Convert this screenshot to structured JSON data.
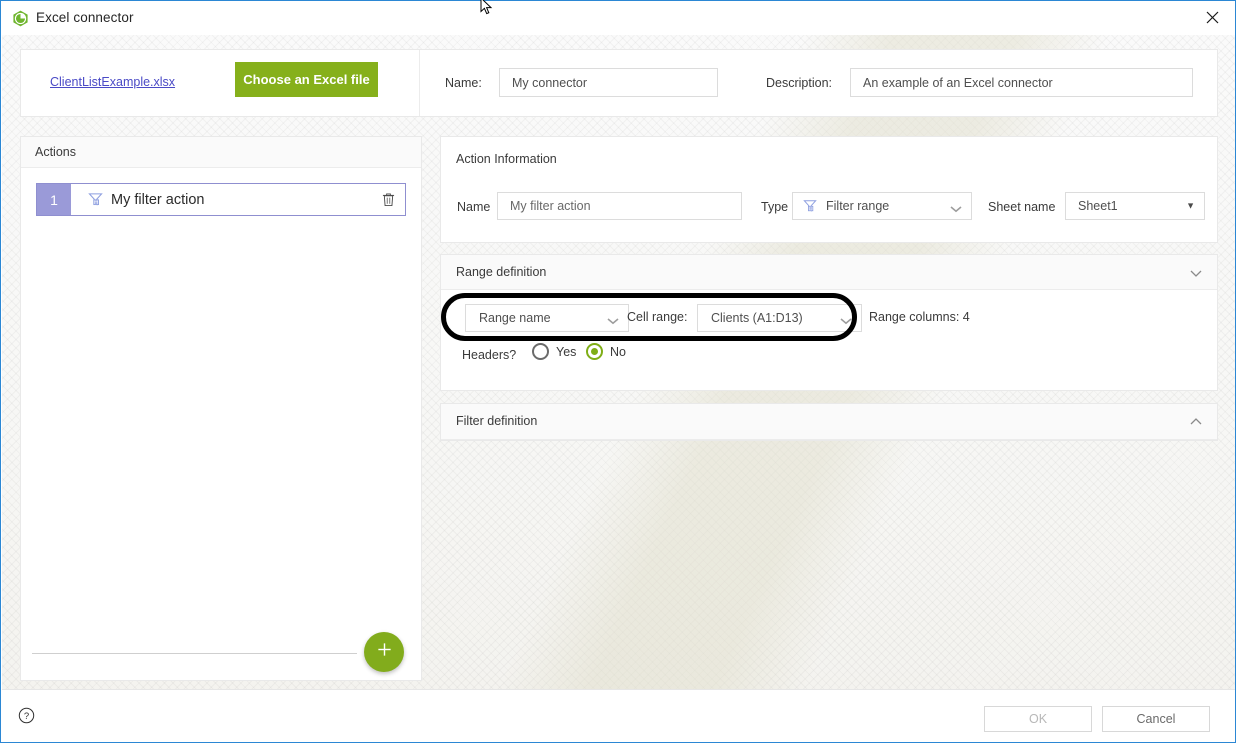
{
  "window": {
    "title": "Excel connector",
    "app_icon": "excel-connector-icon",
    "close_icon": "close-icon"
  },
  "file_card": {
    "file_link": "ClientListExample.xlsx",
    "choose_button": "Choose an Excel file",
    "name_label": "Name:",
    "name_value": "My connector",
    "description_label": "Description:",
    "description_value": "An example of an Excel connector"
  },
  "actions_panel": {
    "header": "Actions",
    "items": [
      {
        "index": "1",
        "icon": "filter-range-icon",
        "label": "My filter action",
        "delete_icon": "trash-icon"
      }
    ],
    "add_button_icon": "plus-icon"
  },
  "action_information": {
    "title": "Action Information",
    "name_label": "Name",
    "name_value": "My filter action",
    "type_label": "Type",
    "type_value": "Filter range",
    "type_icon": "filter-range-icon",
    "sheet_label": "Sheet name",
    "sheet_value": "Sheet1"
  },
  "range_definition": {
    "title": "Range definition",
    "chevron": "chevron-down-icon",
    "range_mode_value": "Range name",
    "cell_range_label": "Cell range:",
    "cell_range_value": "Clients (A1:D13)",
    "range_columns_text": "Range columns: 4",
    "headers_label": "Headers?",
    "headers_yes_label": "Yes",
    "headers_no_label": "No",
    "headers_selected": "No"
  },
  "filter_definition": {
    "title": "Filter definition",
    "chevron": "chevron-up-icon"
  },
  "footer": {
    "help_icon": "help-icon",
    "ok_label": "OK",
    "cancel_label": "Cancel"
  },
  "colors": {
    "accent_green": "#86b01b",
    "link_blue": "#4a4ac6",
    "index_purple": "#9a9ad8",
    "window_border": "#2b87d4"
  }
}
